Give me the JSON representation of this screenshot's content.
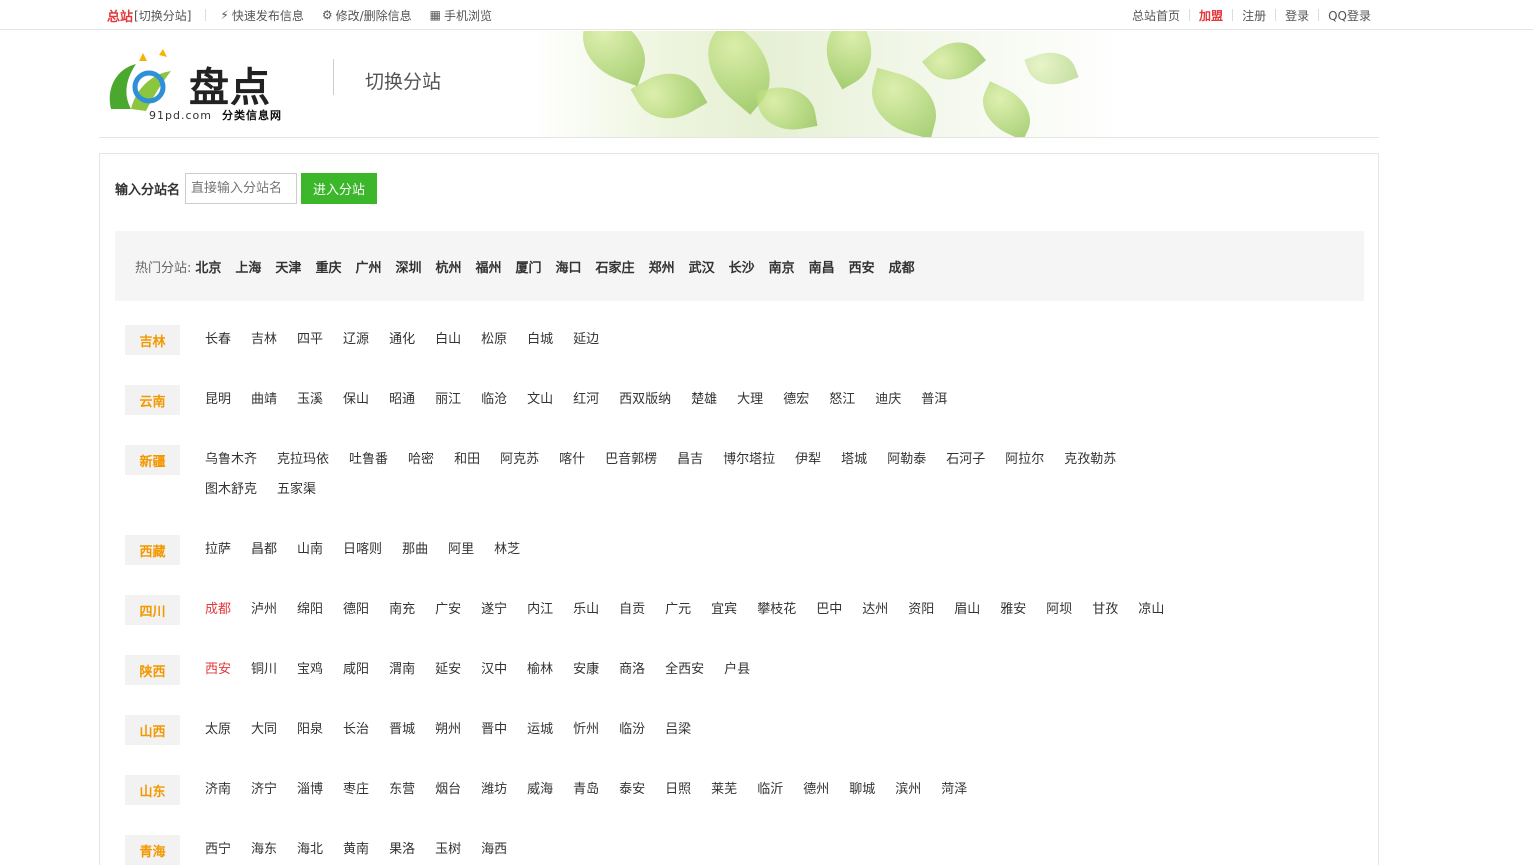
{
  "topbar": {
    "site": "总站",
    "switch": "[切换分站]",
    "links": [
      {
        "icon": "lightning-icon",
        "glyph": "⚡",
        "label": "快速发布信息"
      },
      {
        "icon": "gear-icon",
        "glyph": "⚙",
        "label": "修改/删除信息"
      },
      {
        "icon": "qrcode-icon",
        "glyph": "▦",
        "label": "手机浏览"
      }
    ],
    "right": {
      "home": "总站首页",
      "join": "加盟",
      "register": "注册",
      "login": "登录",
      "qq": "QQ登录"
    }
  },
  "header": {
    "logo_text": "盘点",
    "logo_domain": "91pd.com",
    "logo_sub": "分类信息网",
    "title": "切换分站"
  },
  "search": {
    "label": "输入分站名",
    "placeholder": "直接输入分站名",
    "button": "进入分站"
  },
  "hot": {
    "label": "热门分站:",
    "cities": [
      "北京",
      "上海",
      "天津",
      "重庆",
      "广州",
      "深圳",
      "杭州",
      "福州",
      "厦门",
      "海口",
      "石家庄",
      "郑州",
      "武汉",
      "长沙",
      "南京",
      "南昌",
      "西安",
      "成都"
    ]
  },
  "provinces": [
    {
      "name": "吉林",
      "cities": [
        "长春",
        "吉林",
        "四平",
        "辽源",
        "通化",
        "白山",
        "松原",
        "白城",
        "延边"
      ]
    },
    {
      "name": "云南",
      "cities": [
        "昆明",
        "曲靖",
        "玉溪",
        "保山",
        "昭通",
        "丽江",
        "临沧",
        "文山",
        "红河",
        "西双版纳",
        "楚雄",
        "大理",
        "德宏",
        "怒江",
        "迪庆",
        "普洱"
      ]
    },
    {
      "name": "新疆",
      "cities": [
        "乌鲁木齐",
        "克拉玛依",
        "吐鲁番",
        "哈密",
        "和田",
        "阿克苏",
        "喀什",
        "巴音郭楞",
        "昌吉",
        "博尔塔拉",
        "伊犁",
        "塔城",
        "阿勒泰",
        "石河子",
        "阿拉尔",
        "克孜勒苏",
        "图木舒克",
        "五家渠"
      ]
    },
    {
      "name": "西藏",
      "cities": [
        "拉萨",
        "昌都",
        "山南",
        "日喀则",
        "那曲",
        "阿里",
        "林芝"
      ]
    },
    {
      "name": "四川",
      "cities": [
        "成都",
        "泸州",
        "绵阳",
        "德阳",
        "南充",
        "广安",
        "遂宁",
        "内江",
        "乐山",
        "自贡",
        "广元",
        "宜宾",
        "攀枝花",
        "巴中",
        "达州",
        "资阳",
        "眉山",
        "雅安",
        "阿坝",
        "甘孜",
        "凉山"
      ],
      "active": "成都"
    },
    {
      "name": "陕西",
      "cities": [
        "西安",
        "铜川",
        "宝鸡",
        "咸阳",
        "渭南",
        "延安",
        "汉中",
        "榆林",
        "安康",
        "商洛",
        "全西安",
        "户县"
      ],
      "active": "西安"
    },
    {
      "name": "山西",
      "cities": [
        "太原",
        "大同",
        "阳泉",
        "长治",
        "晋城",
        "朔州",
        "晋中",
        "运城",
        "忻州",
        "临汾",
        "吕梁"
      ]
    },
    {
      "name": "山东",
      "cities": [
        "济南",
        "济宁",
        "淄博",
        "枣庄",
        "东营",
        "烟台",
        "潍坊",
        "威海",
        "青岛",
        "泰安",
        "日照",
        "莱芜",
        "临沂",
        "德州",
        "聊城",
        "滨州",
        "菏泽"
      ]
    },
    {
      "name": "青海",
      "cities": [
        "西宁",
        "海东",
        "海北",
        "黄南",
        "果洛",
        "玉树",
        "海西"
      ]
    }
  ]
}
